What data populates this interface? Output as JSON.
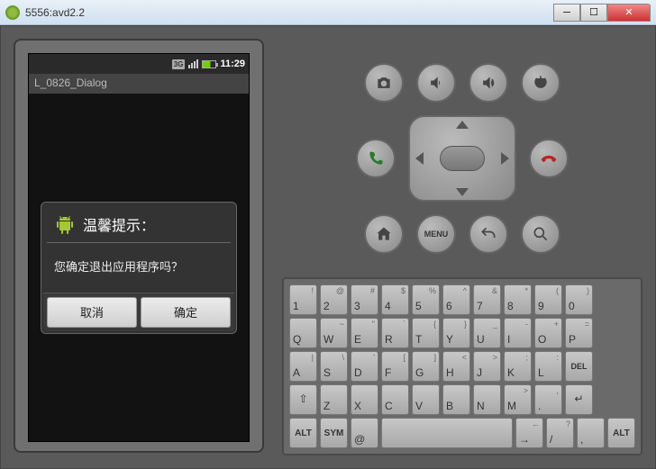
{
  "window": {
    "title": "5556:avd2.2"
  },
  "statusbar": {
    "network": "3G",
    "time": "11:29"
  },
  "appbar": {
    "title": "L_0826_Dialog"
  },
  "dialog": {
    "title": "温馨提示：",
    "message": "您确定退出应用程序吗？",
    "cancel": "取消",
    "ok": "确定"
  },
  "hw": {
    "menu": "MENU"
  },
  "keyboard": {
    "rows": [
      [
        {
          "main": "1",
          "sub": "!"
        },
        {
          "main": "2",
          "sub": "@"
        },
        {
          "main": "3",
          "sub": "#"
        },
        {
          "main": "4",
          "sub": "$"
        },
        {
          "main": "5",
          "sub": "%"
        },
        {
          "main": "6",
          "sub": "^"
        },
        {
          "main": "7",
          "sub": "&"
        },
        {
          "main": "8",
          "sub": "*"
        },
        {
          "main": "9",
          "sub": "("
        },
        {
          "main": "0",
          "sub": ")"
        }
      ],
      [
        {
          "main": "Q"
        },
        {
          "main": "W",
          "sub": "~"
        },
        {
          "main": "E",
          "sub": "\""
        },
        {
          "main": "R",
          "sub": "`"
        },
        {
          "main": "T",
          "sub": "{"
        },
        {
          "main": "Y",
          "sub": "}"
        },
        {
          "main": "U",
          "sub": "_"
        },
        {
          "main": "I",
          "sub": "-"
        },
        {
          "main": "O",
          "sub": "+"
        },
        {
          "main": "P",
          "sub": "="
        }
      ],
      [
        {
          "main": "A",
          "sub": "|"
        },
        {
          "main": "S",
          "sub": "\\"
        },
        {
          "main": "D",
          "sub": "'"
        },
        {
          "main": "F",
          "sub": "["
        },
        {
          "main": "G",
          "sub": "]"
        },
        {
          "main": "H",
          "sub": "<"
        },
        {
          "main": "J",
          "sub": ">"
        },
        {
          "main": "K",
          "sub": ";"
        },
        {
          "main": "L",
          "sub": ":"
        },
        {
          "main": "DEL",
          "type": "del"
        }
      ],
      [
        {
          "main": "⇧",
          "type": "shift"
        },
        {
          "main": "Z"
        },
        {
          "main": "X"
        },
        {
          "main": "C"
        },
        {
          "main": "V"
        },
        {
          "main": "B"
        },
        {
          "main": "N"
        },
        {
          "main": "M",
          "sub": ">"
        },
        {
          "main": ".",
          "sub": ","
        },
        {
          "main": "↵",
          "type": "enter"
        }
      ],
      [
        {
          "main": "ALT",
          "type": "alt"
        },
        {
          "main": "SYM",
          "type": "alt"
        },
        {
          "main": "@"
        },
        {
          "main": "",
          "type": "space"
        },
        {
          "main": "→",
          "sub": "←"
        },
        {
          "main": "/",
          "sub": "?"
        },
        {
          "main": ",",
          "sub": ""
        },
        {
          "main": "ALT",
          "type": "alt"
        }
      ]
    ]
  }
}
